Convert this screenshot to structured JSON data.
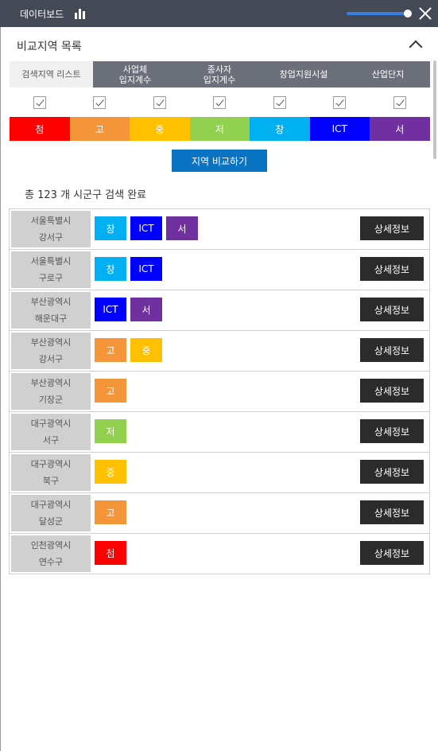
{
  "header": {
    "title": "데이터보드",
    "slider_value": 1.0
  },
  "panel": {
    "title": "비교지역 목록"
  },
  "tabs": [
    {
      "label": "검색지역 리스트",
      "active": true
    },
    {
      "label": "사업체\n입지계수",
      "active": false
    },
    {
      "label": "종사자\n입지계수",
      "active": false
    },
    {
      "label": "창업지원시설",
      "active": false
    },
    {
      "label": "산업단지",
      "active": false
    }
  ],
  "checkboxes": [
    true,
    true,
    true,
    true,
    true,
    true,
    true
  ],
  "categories": [
    {
      "label": "첨",
      "color": "#ff0000"
    },
    {
      "label": "고",
      "color": "#f5953a"
    },
    {
      "label": "중",
      "color": "#ffc000"
    },
    {
      "label": "저",
      "color": "#92d050"
    },
    {
      "label": "창",
      "color": "#00b0f0"
    },
    {
      "label": "ICT",
      "color": "#0000ff"
    },
    {
      "label": "서",
      "color": "#7030a0"
    }
  ],
  "compare_button": "지역 비교하기",
  "summary": "총 123 개 시군구 검색 완료",
  "detail_label": "상세정보",
  "rows": [
    {
      "city": "서울특별시",
      "district": "강서구",
      "tags": [
        "창",
        "ICT",
        "서"
      ]
    },
    {
      "city": "서울특별시",
      "district": "구로구",
      "tags": [
        "창",
        "ICT"
      ]
    },
    {
      "city": "부산광역시",
      "district": "해운대구",
      "tags": [
        "ICT",
        "서"
      ]
    },
    {
      "city": "부산광역시",
      "district": "강서구",
      "tags": [
        "고",
        "중"
      ]
    },
    {
      "city": "부산광역시",
      "district": "기장군",
      "tags": [
        "고"
      ]
    },
    {
      "city": "대구광역시",
      "district": "서구",
      "tags": [
        "저"
      ]
    },
    {
      "city": "대구광역시",
      "district": "북구",
      "tags": [
        "중"
      ]
    },
    {
      "city": "대구광역시",
      "district": "달성군",
      "tags": [
        "고"
      ]
    },
    {
      "city": "인천광역시",
      "district": "연수구",
      "tags": [
        "첨"
      ]
    }
  ]
}
